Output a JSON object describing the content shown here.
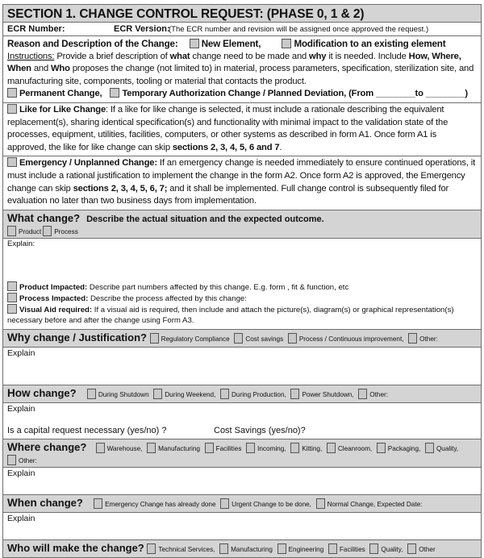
{
  "section": {
    "title": "SECTION 1. CHANGE CONTROL REQUEST: (PHASE 0, 1 & 2)",
    "ecr_number_label": "ECR Number:",
    "ecr_version_label": "ECR Version:",
    "ecr_note": "(The ECR number and revision will be assigned once approved the request.)"
  },
  "reason": {
    "label": "Reason and Description of the Change:",
    "opt_new": "New Element,",
    "opt_mod": "Modification to an existing element",
    "instr_label": "Instructions:",
    "instr_1": " Provide a brief description of ",
    "what": "what",
    "instr_2": " change need to be made and ",
    "why": "why",
    "instr_3": " it is needed. Include ",
    "how_where_when": "How, Where, When",
    "instr_4": " and ",
    "who": "Who",
    "instr_5": " proposes the change (not limited to) in material, process parameters, specification, sterilization site, and manufacturing site, components, tooling or material that contacts the product.",
    "permanent": "Permanent Change,",
    "temporary": "Temporary Authorization Change / Planned Deviation, (From ________to ________)"
  },
  "like_for_like": {
    "label": "Like for Like Change",
    "text_1": ": If a like for like change is selected, it must include a rationale describing the equivalent replacement(s), sharing identical specification(s) and functionality with minimal impact to the validation state of the processes, equipment, utilities, facilities, computers, or other systems as described in form A1.  Once form A1 is approved, the like for like change can skip ",
    "sections": "sections 2, 3, 4, 5, 6 and 7",
    "text_2": "."
  },
  "emergency": {
    "label": "Emergency / Unplanned Change:",
    "text_1": " If an emergency change is needed immediately to ensure continued operations, it must include a rational justification to implement the change in the form A2.  Once form A2 is approved, the Emergency change can skip ",
    "sections": "sections 2, 3, 4, 5, 6, 7;",
    "text_2": " and it shall be implemented. Full change control is subsequently filed for evaluation no later than two business days from implementation."
  },
  "what_change": {
    "title_1": "What",
    "title_2": " change?",
    "desc": "Describe the actual situation and the expected outcome.",
    "options": [
      "Product",
      "Process"
    ],
    "explain": "Explain:",
    "product_impacted_label": "Product Impacted:",
    "product_impacted_text": " Describe part numbers affected by this change. E.g. form , fit & function, etc",
    "process_impacted_label": "Process Impacted:",
    "process_impacted_text": " Describe the process affected by this change:",
    "visual_aid_label": "Visual Aid required:",
    "visual_aid_text": " If a visual aid is required, then include and attach the picture(s), diagram(s) or graphical representation(s) necessary before and after the change using Form A3."
  },
  "why_change": {
    "title_1": "Why",
    "title_2": " change / Justification?",
    "options": [
      "Regulatory Compliance",
      "Cost savings",
      "Process / Continuous improvement,",
      "Other:"
    ],
    "explain": "Explain"
  },
  "how_change": {
    "title_1": "How",
    "title_2": " change?",
    "options": [
      "During Shutdown",
      "During Weekend,",
      "During Production,",
      "Power Shutdown,",
      "Other:"
    ],
    "explain": "Explain",
    "capital_request": "Is a capital request necessary (yes/no) ?",
    "cost_savings": "Cost Savings (yes/no)?"
  },
  "where_change": {
    "title_1": "Where",
    "title_2": " change?",
    "options": [
      "Warehouse,",
      "Manufacturing",
      "Facilities",
      "Incoming,",
      "Kitting,",
      "Cleanroom,",
      "Packaging,",
      "Quality,",
      "Other:"
    ],
    "explain": "Explain"
  },
  "when_change": {
    "title_1": "When",
    "title_2": " change?",
    "options": [
      "Emergency Change has already done",
      "Urgent Change to be done,",
      "Normal Change, Expected Date:"
    ],
    "explain": "Explain"
  },
  "who_change": {
    "title": "Who will make the change?",
    "options": [
      "Technical Services,",
      "Manufacturing",
      "Engineering",
      "Facilities",
      "Quality,",
      "Other"
    ]
  }
}
